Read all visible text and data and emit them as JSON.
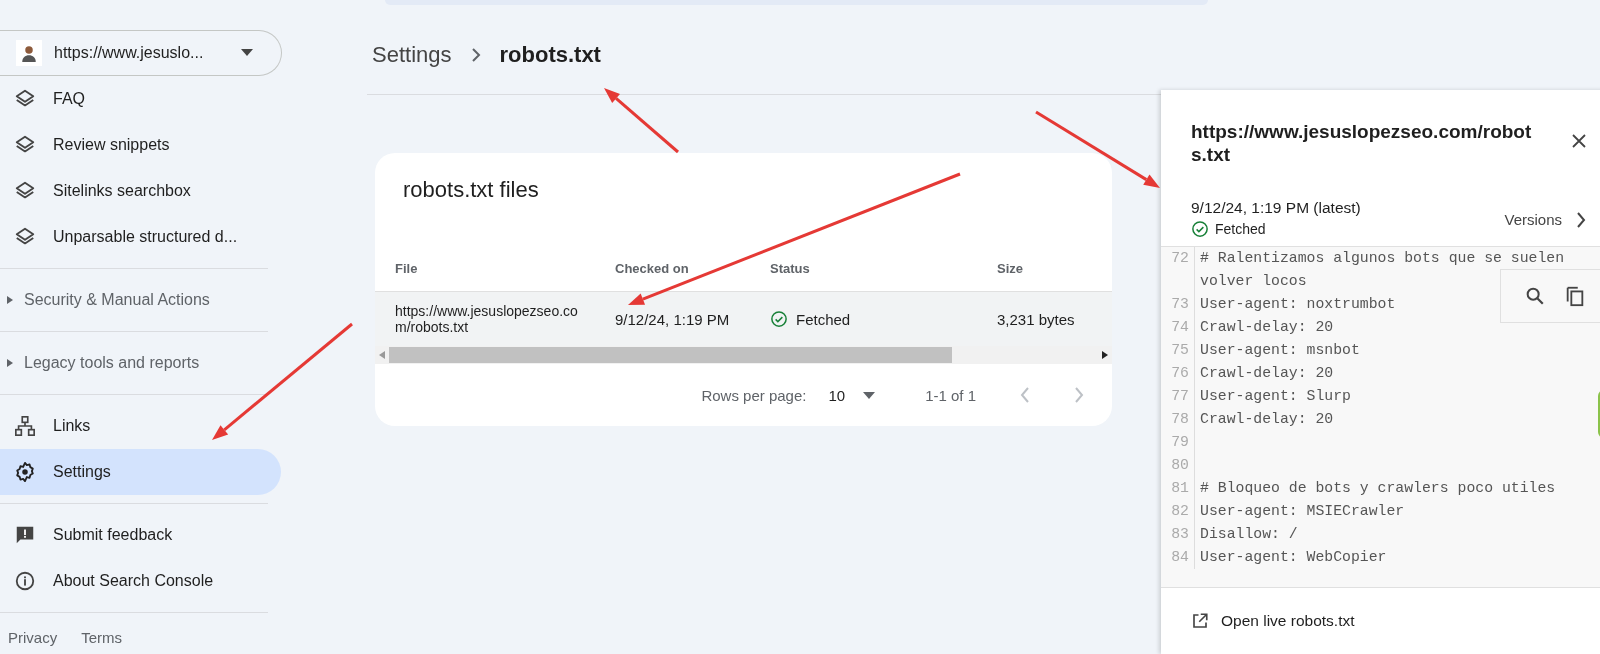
{
  "property_selector": {
    "label": "https://www.jesuslo..."
  },
  "nav": {
    "structured_data_items": [
      {
        "label": "FAQ",
        "selected": false
      },
      {
        "label": "Review snippets",
        "selected": false
      },
      {
        "label": "Sitelinks searchbox",
        "selected": false
      },
      {
        "label": "Unparsable structured d...",
        "selected": false
      }
    ],
    "sections": [
      {
        "label": "Security & Manual Actions",
        "expanded": false
      },
      {
        "label": "Legacy tools and reports",
        "expanded": false
      }
    ],
    "tools": [
      {
        "label": "Links",
        "selected": false
      },
      {
        "label": "Settings",
        "selected": true
      }
    ],
    "help": [
      {
        "label": "Submit feedback",
        "selected": false
      },
      {
        "label": "About Search Console",
        "selected": false
      }
    ],
    "footer_links": [
      "Privacy",
      "Terms"
    ]
  },
  "breadcrumb": [
    "Settings",
    "robots.txt"
  ],
  "card": {
    "title": "robots.txt files",
    "table": {
      "columns": [
        "File",
        "Checked on",
        "Status",
        "Size"
      ],
      "rows": [
        {
          "file": "https://www.jesuslopezseo.com/robots.txt",
          "checked_on": "9/12/24, 1:19 PM",
          "status": "Fetched",
          "size": "3,231 bytes",
          "selected": true
        }
      ]
    },
    "pagination": {
      "rows_per_page_label": "Rows per page:",
      "rows_per_page": "10",
      "range": "1-1 of 1"
    }
  },
  "panel": {
    "title": "https://www.jesuslopezseo.com/robots.txt",
    "date": "9/12/24, 1:19 PM (latest)",
    "status": "Fetched",
    "versions_label": "Versions",
    "code_lines": [
      {
        "number": "72",
        "text": "# Ralentizamos algunos bots que se suelen volver locos"
      },
      {
        "number": "73",
        "text": "User-agent: noxtrumbot"
      },
      {
        "number": "74",
        "text": "Crawl-delay: 20"
      },
      {
        "number": "75",
        "text": "User-agent: msnbot"
      },
      {
        "number": "76",
        "text": "Crawl-delay: 20"
      },
      {
        "number": "77",
        "text": "User-agent: Slurp"
      },
      {
        "number": "78",
        "text": "Crawl-delay: 20"
      },
      {
        "number": "79"
      },
      {
        "number": "80"
      },
      {
        "number": "81",
        "text": "# Bloqueo de bots y crawlers poco utiles"
      },
      {
        "number": "82",
        "text": "User-agent: MSIECrawler"
      },
      {
        "number": "83",
        "text": "Disallow: /"
      },
      {
        "number": "84",
        "text": "User-agent: WebCopier"
      }
    ],
    "footer_link": "Open live robots.txt"
  }
}
